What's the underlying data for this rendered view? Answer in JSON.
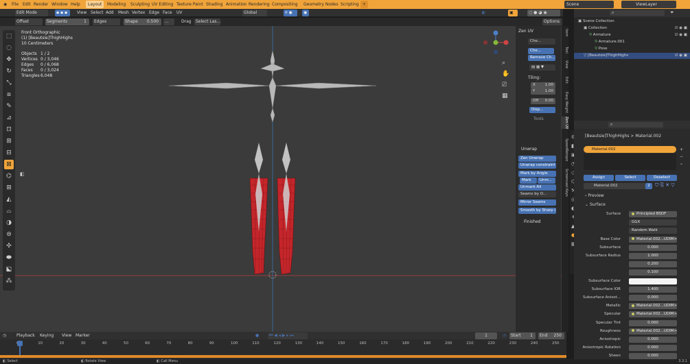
{
  "menu": {
    "file": "File",
    "edit": "Edit",
    "render": "Render",
    "window": "Window",
    "help": "Help"
  },
  "workspaces": [
    "Layout",
    "Modeling",
    "Sculpting",
    "UV Editing",
    "Texture Paint",
    "Shading",
    "Animation",
    "Rendering",
    "Compositing",
    "Geometry Nodes",
    "Scripting"
  ],
  "active_workspace": "Layout",
  "scene": {
    "label": "Scene",
    "view_layer": "ViewLayer"
  },
  "editor_header": {
    "mode": "Edit Mode",
    "view": "View",
    "select": "Select",
    "add": "Add",
    "mesh": "Mesh",
    "vertex": "Vertex",
    "edge": "Edge",
    "face": "Face",
    "uv": "UV",
    "orientation": "Global",
    "options": "Options"
  },
  "tool_header": {
    "tool": "Offset",
    "segments_label": "Segments",
    "segments_value": "1",
    "edges": "Edges",
    "shape_label": "Shape",
    "shape_value": "0.500",
    "more": "...",
    "drag_label": "Drag",
    "drag_value": "Select Las..."
  },
  "viewport_info": {
    "view": "Front Orthographic",
    "object": "(1) [Beautsie]ThighHighs",
    "scale": "10 Centimeters",
    "stats": [
      {
        "label": "Objects",
        "value": "1 / 2"
      },
      {
        "label": "Vertices",
        "value": "0 / 3,046"
      },
      {
        "label": "Edges",
        "value": "0 / 6,068"
      },
      {
        "label": "Faces",
        "value": "0 / 3,024"
      },
      {
        "label": "Triangles",
        "value": "6,048"
      }
    ]
  },
  "npanel": {
    "zen_uv": "Zen UV",
    "che": "Che...",
    "che2": "Che...",
    "remove": "Remove Ch...",
    "tiling": "Tiling:",
    "tx_label": "X",
    "tx_value": "1.00",
    "ty_label": "Y",
    "ty_value": "1.00",
    "off_label": "Off",
    "off_value": "0.00",
    "disp": "Disp...",
    "tools": "Tools",
    "unwrap": "Unwrap",
    "zen_unwrap": "Zen Unwrap",
    "unwrap_constraint": "Unwrap constraint",
    "mark_by_angle": "Mark by Angle",
    "mark": "Mark",
    "unm": "Unm...",
    "unmark_all": "Unmark All",
    "seams_by": "Seams by O...",
    "mirror_seams": "Mirror Seams",
    "smooth_sharp": "Smooth by Sharp (...",
    "finished": "Finished"
  },
  "ntabs": [
    "Item",
    "Tool",
    "View",
    "Edit",
    "Easy Weight",
    "Zen UV",
    "SpeedRetopo",
    "Screencast Keys"
  ],
  "outliner": {
    "rows": [
      {
        "label": "Scene Collection",
        "indent": 0
      },
      {
        "label": "Collection",
        "indent": 1
      },
      {
        "label": "Armature",
        "indent": 2
      },
      {
        "label": "Armature.001",
        "indent": 3
      },
      {
        "label": "Pose",
        "indent": 3
      },
      {
        "label": "[Beautsie]ThighHighs",
        "indent": 1
      }
    ]
  },
  "properties": {
    "object": "[Beautsie]ThighHighs",
    "material": "Material.002",
    "slot": "Material.002",
    "assign": "Assign",
    "select": "Select",
    "deselect": "Deselect",
    "mat_name": "Material.002",
    "users": "2",
    "preview": "Preview",
    "surface_section": "Surface",
    "rows": [
      {
        "label": "Surface",
        "value": "Principled BSDF",
        "type": "link"
      },
      {
        "label": "",
        "value": "GGX",
        "type": "menu"
      },
      {
        "label": "",
        "value": "Random Walk",
        "type": "menu"
      },
      {
        "label": "Base Color",
        "value": "Material.002...UDIM>.png",
        "type": "link"
      },
      {
        "label": "Subsurface",
        "value": "0.000",
        "type": "num"
      },
      {
        "label": "Subsurface Radius",
        "value": "1.000",
        "type": "num"
      },
      {
        "label": "",
        "value": "0.200",
        "type": "num"
      },
      {
        "label": "",
        "value": "0.100",
        "type": "num"
      },
      {
        "label": "Subsurface Color",
        "value": "",
        "type": "color"
      },
      {
        "label": "Subsurface IOR",
        "value": "1.400",
        "type": "num"
      },
      {
        "label": "Subsurface Anisot...",
        "value": "0.000",
        "type": "num"
      },
      {
        "label": "Metallic",
        "value": "Material.002...UDIM>.png",
        "type": "link"
      },
      {
        "label": "Specular",
        "value": "Material.002...UDIM>.png",
        "type": "link"
      },
      {
        "label": "Specular Tint",
        "value": "0.000",
        "type": "num"
      },
      {
        "label": "Roughness",
        "value": "Material.002...UDIM>.png",
        "type": "link"
      },
      {
        "label": "Anisotropic",
        "value": "0.000",
        "type": "num"
      },
      {
        "label": "Anisotropic Rotation",
        "value": "0.000",
        "type": "num"
      },
      {
        "label": "Sheen",
        "value": "0.000",
        "type": "num"
      }
    ]
  },
  "timeline": {
    "playback": "Playback",
    "keying": "Keying",
    "view": "View",
    "marker": "Marker",
    "current_frame": "1",
    "start_label": "Start",
    "start": "1",
    "end_label": "End",
    "end": "250",
    "ticks": [
      "0",
      "10",
      "20",
      "30",
      "40",
      "50",
      "60",
      "70",
      "80",
      "90",
      "100",
      "110",
      "120",
      "130",
      "140",
      "150",
      "160",
      "170",
      "180",
      "190",
      "200",
      "210",
      "220",
      "230",
      "240",
      "250"
    ]
  },
  "status": {
    "select": "Select",
    "rotate": "Rotate View",
    "call_menu": "Call Menu",
    "version": "3.3.1"
  },
  "colors": {
    "accent": "#f0a43a",
    "selection": "#4772b3",
    "mesh_red": "#c8262b"
  }
}
